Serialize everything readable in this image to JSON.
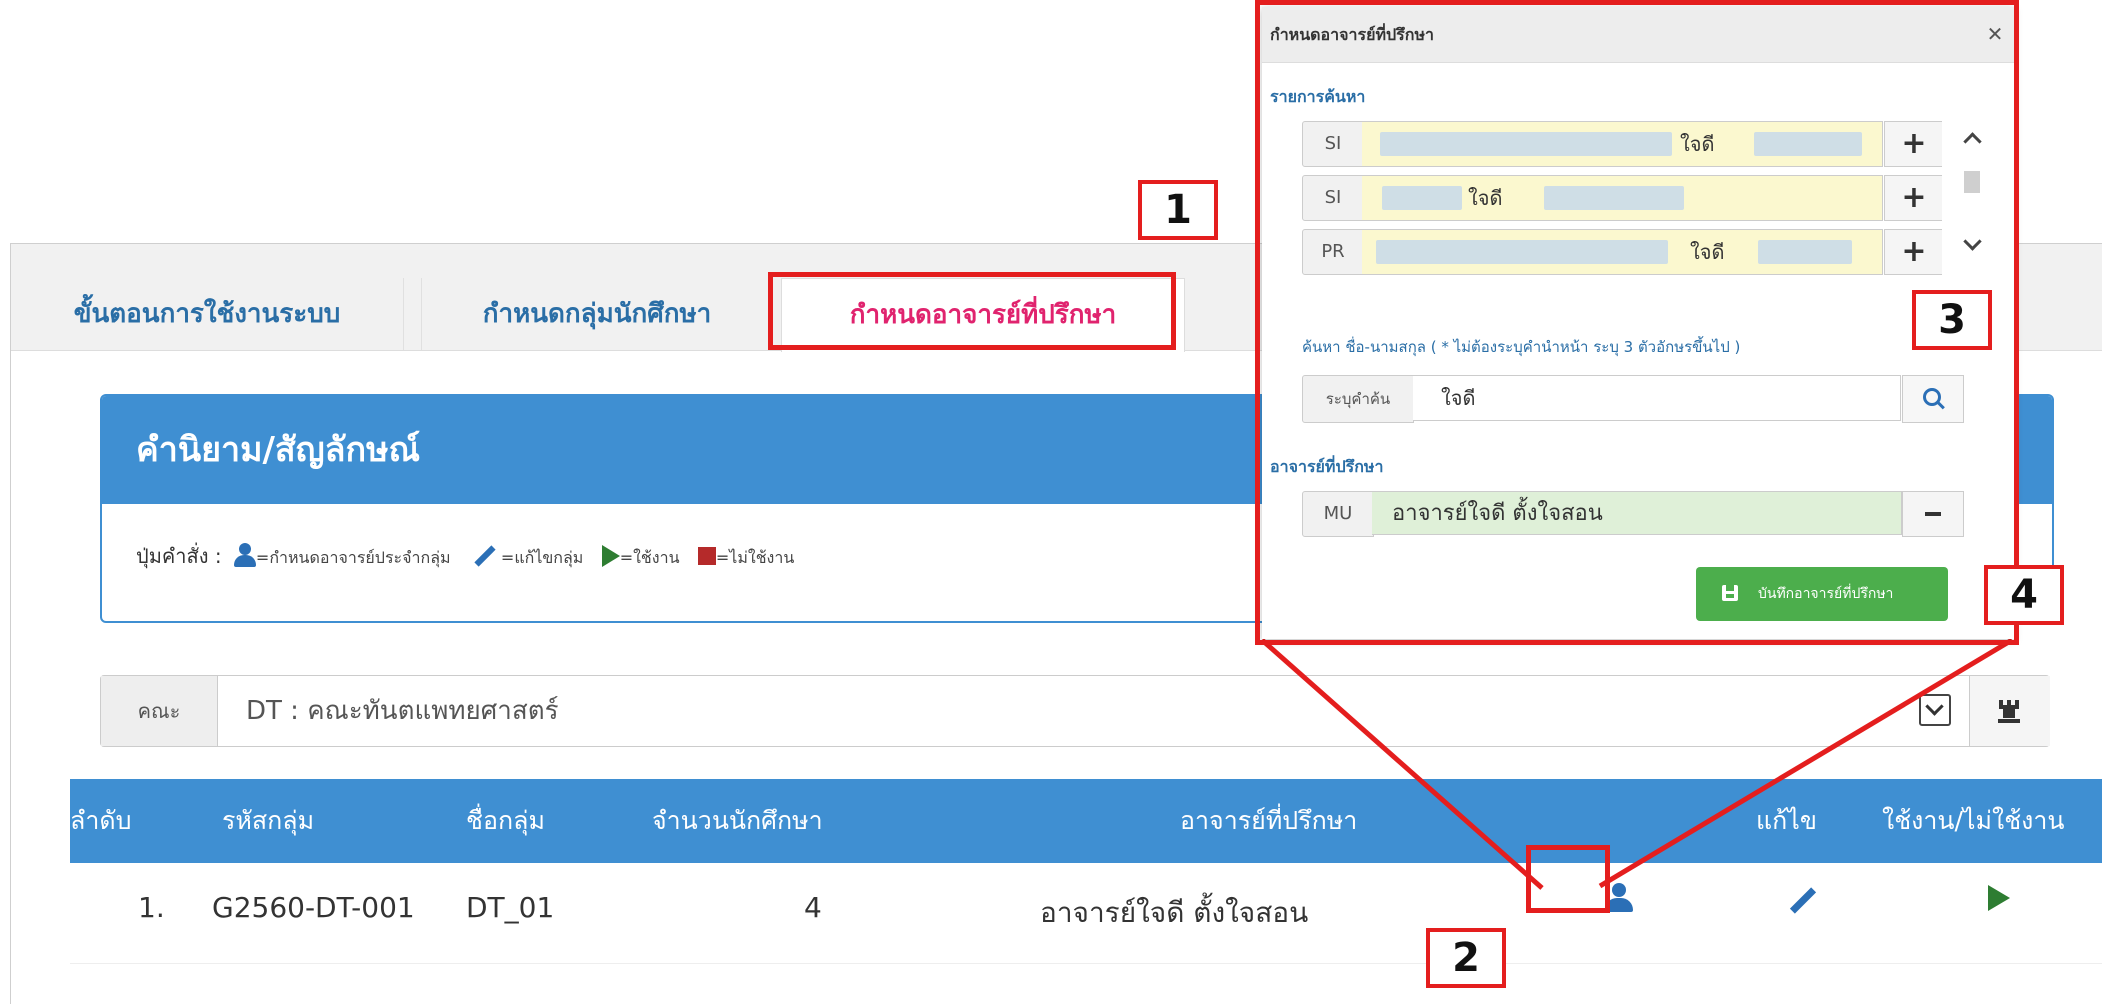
{
  "tabs": [
    {
      "label": "ขั้นตอนการใช้งานระบบ"
    },
    {
      "label": "กำหนดกลุ่มนักศึกษา"
    },
    {
      "label": "กำหนดอาจารย์ที่ปรึกษา",
      "active": true
    }
  ],
  "definitions": {
    "title": "คำนิยาม/สัญลักษณ์",
    "prefix": "ปุ่มคำสั่ง :",
    "legend": {
      "assign": "=กำหนดอาจารย์ประจำกลุ่ม",
      "edit": "=แก้ไขกลุ่ม",
      "enable": "=ใช้งาน",
      "disable": "=ไม่ใช้งาน"
    }
  },
  "faculty": {
    "label": "คณะ",
    "value": "DT : คณะทันตแพทยศาสตร์"
  },
  "table": {
    "headers": [
      "ลำดับ",
      "รหัสกลุ่ม",
      "ชื่อกลุ่ม",
      "จำนวนนักศึกษา",
      "อาจารย์ที่ปรึกษา",
      "แก้ไข",
      "ใช้งาน/ไม่ใช้งาน"
    ],
    "rows": [
      {
        "index": "1.",
        "code": "G2560-DT-001",
        "name": "DT_01",
        "count": "4",
        "advisor": "อาจารย์ใจดี  ตั้งใจสอน"
      }
    ]
  },
  "modal": {
    "title": "กำหนดอาจารย์ที่ปรึกษา",
    "search_results_title": "รายการค้นหา",
    "results": [
      {
        "code": "SI",
        "name": "ใจดี"
      },
      {
        "code": "SI",
        "name": "ใจดี"
      },
      {
        "code": "PR",
        "name": "ใจดี"
      }
    ],
    "search_hint": "ค้นหา ชื่อ-นามสกุล ( * ไม่ต้องระบุคำนำหน้า ระบุ 3 ตัวอักษรขึ้นไป )",
    "search_label": "ระบุคำค้น",
    "search_value": "ใจดี",
    "advisor_title": "อาจารย์ที่ปรึกษา",
    "advisor": {
      "code": "MU",
      "name": "อาจารย์ใจดี  ตั้งใจสอน"
    },
    "save_label": "บันทึกอาจารย์ที่ปรึกษา"
  },
  "callouts": [
    "1",
    "2",
    "3",
    "4"
  ],
  "colors": {
    "primary": "#3f8fd2",
    "active_tab": "#e0236e",
    "highlight": "#e41e1e",
    "save": "#4cae4c"
  }
}
